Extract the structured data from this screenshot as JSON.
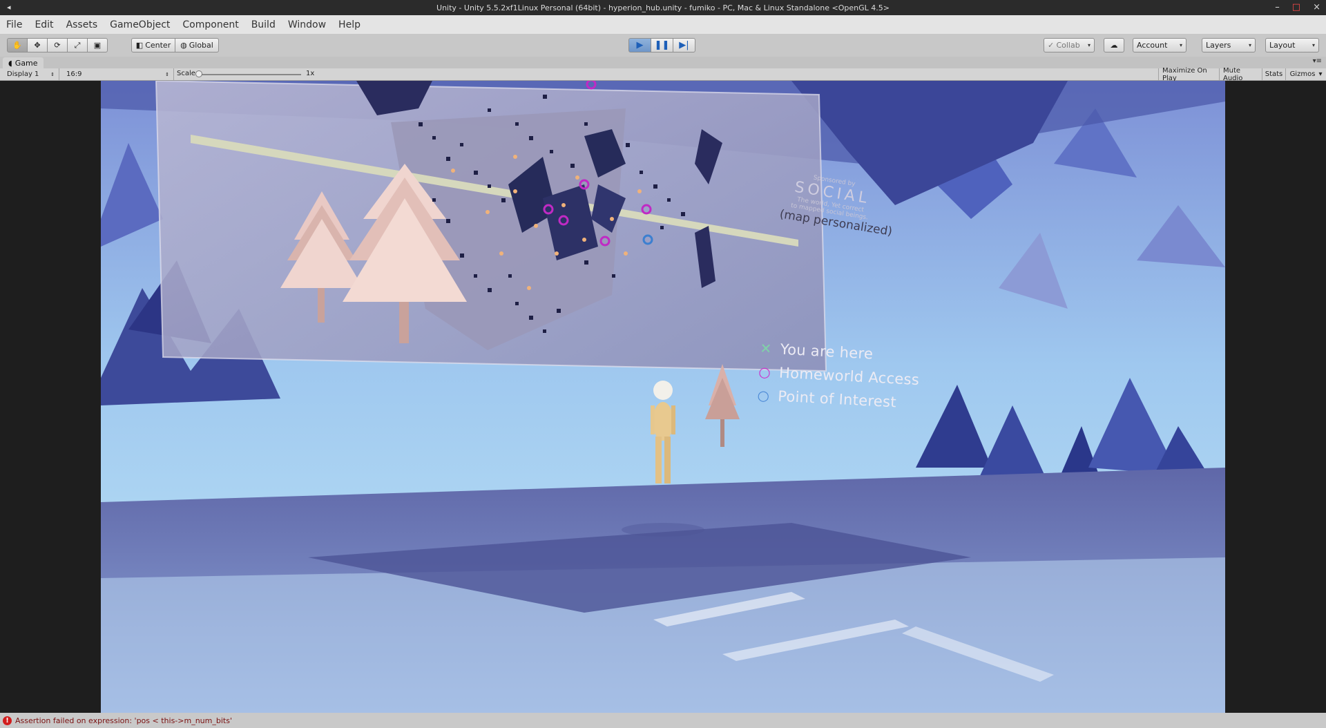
{
  "window": {
    "title": "Unity - Unity 5.5.2xf1Linux Personal (64bit) - hyperion_hub.unity - fumiko - PC, Mac & Linux Standalone <OpenGL 4.5>",
    "minimize_glyph": "–",
    "maximize_glyph": "□",
    "close_glyph": "×"
  },
  "menu": {
    "items": [
      "File",
      "Edit",
      "Assets",
      "GameObject",
      "Component",
      "Build",
      "Window",
      "Help"
    ]
  },
  "toolbar": {
    "pivot_mode": "Center",
    "pivot_rotation": "Global",
    "collab": "Collab",
    "account": "Account",
    "layers": "Layers",
    "layout": "Layout",
    "play_state": "playing"
  },
  "game_view": {
    "tab_label": "Game",
    "display": "Display 1",
    "aspect": "16:9",
    "scale_label": "Scale",
    "scale_value": "1x",
    "scale_level": 0.0,
    "maximize_on_play": "Maximize On Play",
    "mute_audio": "Mute Audio",
    "stats": "Stats",
    "gizmos": "Gizmos"
  },
  "scene": {
    "legend": [
      {
        "icon": "x-marker-icon",
        "symbol": "✕",
        "color": "#7fd3a8",
        "label": "You are here"
      },
      {
        "icon": "ring-magenta-icon",
        "symbol": "○",
        "color": "#cc33cc",
        "label": "Homeworld Access"
      },
      {
        "icon": "ring-blue-icon",
        "symbol": "○",
        "color": "#4d8ad6",
        "label": "Point of Interest"
      }
    ],
    "sponsor_line1": "Sponsored by",
    "sponsor_name": "SOCIAL",
    "sponsor_line2": "The world, Yet correct",
    "sponsor_line3": "to mapped social beings.",
    "map_label": "(map personalized)"
  },
  "status": {
    "message": "Assertion failed on expression: 'pos < this->m_num_bits'"
  }
}
